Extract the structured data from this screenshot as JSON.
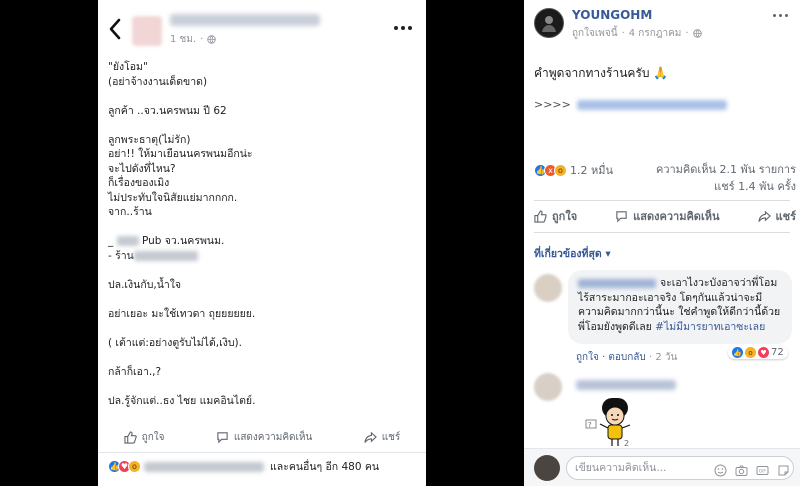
{
  "left_post": {
    "time": "1 ชม.",
    "body_lines": [
      "\"ยังโอม\"",
      "(อย่าจ้างงานเด็ดขาด)",
      "",
      "ลูกค้า ..จว.นครพนม ปี 62",
      "",
      "ลูกพระธาตุ(ไม่รัก)",
      "อย่า!! ให้มาเยือนนครพนมอีกน่ะ",
      "จะไปดังที่ไหน?",
      "ก็เรื่องของเมิง",
      "ไม่ประทับใจนิสัยแย่มากกกก.",
      "จาก..ร้าน",
      "",
      "Pub จว.นครพนม.",
      "- ร้าน",
      "",
      "ปล.เงินกับ,น้ำใจ",
      "",
      "อย่าเยอะ มะใช้เทวดา ถุยยยยยย.",
      "",
      "( เต้าแต่:อย่างตูรับไม่ได้,เงิบ).",
      "",
      "กล้าก็เอา.,?",
      "",
      "ปล.รู้จักแต่..ธง ไชย แมคอินไตย์."
    ],
    "actions": {
      "like": "ถูกใจ",
      "comment": "แสดงความคิดเห็น",
      "share": "แชร์"
    },
    "reactions_summary": "และคนอื่นๆ อีก 480 คน"
  },
  "right_post": {
    "page_name": "YOUNGOHM",
    "liked_by": "ถูกใจเพจนี้",
    "date": "4 กรกฎาคม",
    "text": "คำพูดจากทางร้านครับ 🙏",
    "link_prefix": ">>>>",
    "reaction_count": "1.2 หมื่น",
    "comments_count": "ความคิดเห็น 2.1 พัน รายการ",
    "shares_count": "แชร์ 1.4 พัน ครั้ง",
    "actions": {
      "like": "ถูกใจ",
      "comment": "แสดงความคิดเห็น",
      "share": "แชร์"
    },
    "sort_label": "ที่เกี่ยวข้องที่สุด ▾",
    "comment1": {
      "text": "จะเอาไงวะบังอาจว่าพี่โอม ไร้สาระมากอะเอาจริง โดๆกันแล้วน่าจะมีความคิดมากกว่านี้นะ ใช่คำพูดให้ดีกว่านี้ด้วยพี่โอมยังพูดดีเลย",
      "hashtag": "#ไม่มีมารยาทเอาซะเลย",
      "reaction_count": "72",
      "like_link": "ถูกใจ",
      "reply_link": "ตอบกลับ",
      "time": "2 วัน"
    },
    "sticker_count": "2",
    "input_placeholder": "เขียนความคิดเห็น...",
    "brand_color": "#385898"
  }
}
